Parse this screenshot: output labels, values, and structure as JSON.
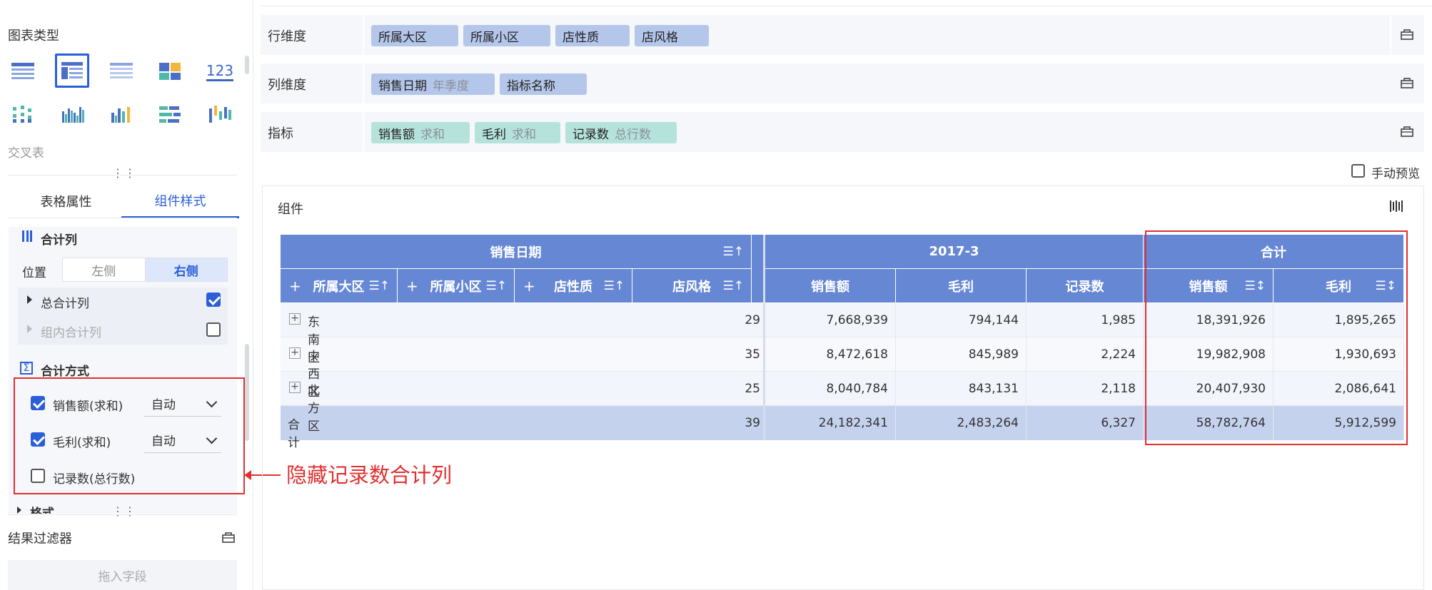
{
  "left": {
    "chart_type_title": "图表类型",
    "chart_type_selected_name": "交叉表",
    "chart_icon_123": "123",
    "dots": "⋮⋮",
    "tabs": [
      "表格属性",
      "组件样式"
    ],
    "total_col_title": "合计列",
    "position_label": "位置",
    "position_options": [
      "左侧",
      "右侧"
    ],
    "grand_total_col": "总合计列",
    "group_total_col": "组内合计列",
    "total_method_title": "合计方式",
    "methods": [
      {
        "label": "销售额(求和)",
        "checked": true,
        "mode": "自动"
      },
      {
        "label": "毛利(求和)",
        "checked": true,
        "mode": "自动"
      },
      {
        "label": "记录数(总行数)",
        "checked": false
      }
    ],
    "format_partial": "格式",
    "result_filter_title": "结果过滤器",
    "drop_field_placeholder": "拖入字段",
    "annotation": "隐藏记录数合计列",
    "accent_color": "#2b5fd9",
    "annotation_color": "#e03030"
  },
  "dims": {
    "row_label": "行维度",
    "row_chips": [
      "所属大区",
      "所属小区",
      "店性质",
      "店风格"
    ],
    "col_label": "列维度",
    "col_chips": [
      {
        "name": "销售日期",
        "sub": "年季度"
      },
      {
        "name": "指标名称",
        "sub": ""
      }
    ],
    "metric_label": "指标",
    "metric_chips": [
      {
        "name": "销售额",
        "sub": "求和"
      },
      {
        "name": "毛利",
        "sub": "求和"
      },
      {
        "name": "记录数",
        "sub": "总行数"
      }
    ],
    "manual_preview": "手动预览"
  },
  "component": {
    "title": "组件",
    "header_top": {
      "date": "销售日期",
      "period": "2017-3",
      "total": "合计"
    },
    "row_headers": [
      "所属大区",
      "所属小区",
      "店性质",
      "店风格"
    ],
    "measure_headers": [
      "销售额",
      "毛利",
      "记录数"
    ],
    "total_headers": [
      "销售额",
      "毛利"
    ],
    "rows": [
      {
        "name": "东南区",
        "clip": "29",
        "sales": "7,668,939",
        "profit": "794,144",
        "count": "1,985",
        "t_sales": "18,391,926",
        "t_profit": "1,895,265"
      },
      {
        "name": "中西区",
        "clip": "35",
        "sales": "8,472,618",
        "profit": "845,989",
        "count": "2,224",
        "t_sales": "19,982,908",
        "t_profit": "1,930,693"
      },
      {
        "name": "北方区",
        "clip": "25",
        "sales": "8,040,784",
        "profit": "843,131",
        "count": "2,118",
        "t_sales": "20,407,930",
        "t_profit": "2,086,641"
      }
    ],
    "total_row": {
      "name": "合计",
      "clip": "39",
      "sales": "24,182,341",
      "profit": "2,483,264",
      "count": "6,327",
      "t_sales": "58,782,764",
      "t_profit": "5,912,599"
    }
  }
}
